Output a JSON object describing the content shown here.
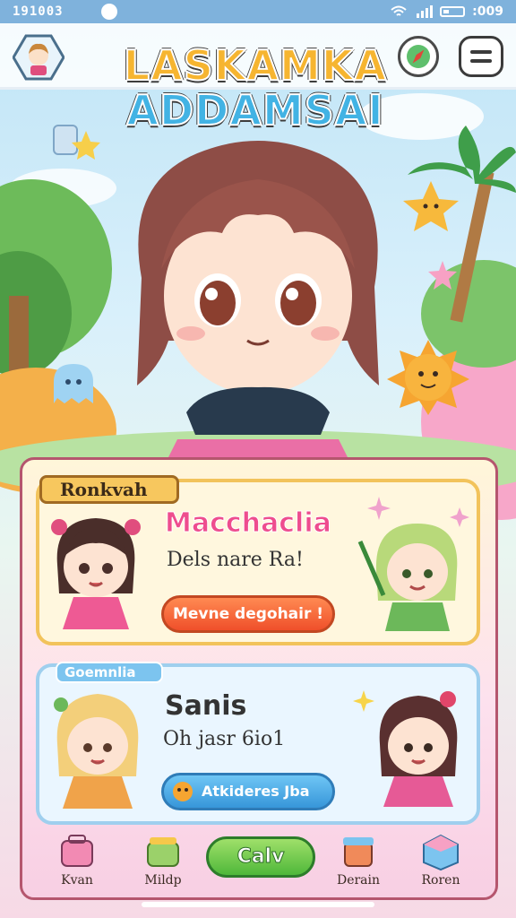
{
  "status_bar": {
    "time": "191003",
    "right_time": ":009"
  },
  "header": {
    "title_line1": "LASKAMKA",
    "title_line2": "ADDAMSAI"
  },
  "icons": {
    "avatar": "player-avatar-icon",
    "compass": "compass-icon",
    "menu": "hamburger-menu-icon"
  },
  "cards": [
    {
      "tag": "Ronkvah",
      "title": "Macchaclia",
      "subtitle": "Dels nare Ra!",
      "button": "Mevne degohair !"
    },
    {
      "tag": "Goemnlia",
      "title": "Sanis",
      "subtitle": "Oh jasr 6io1",
      "button": "Atkideres Jba"
    }
  ],
  "bottom_nav": {
    "items": [
      "Kvan",
      "Mildp",
      "Derain",
      "Roren"
    ],
    "cta": "Calv"
  },
  "colors": {
    "primary_pink": "#ee4d8e",
    "accent_orange": "#ef4f2a",
    "accent_blue": "#3796d9",
    "cta_green": "#4fb83a"
  }
}
